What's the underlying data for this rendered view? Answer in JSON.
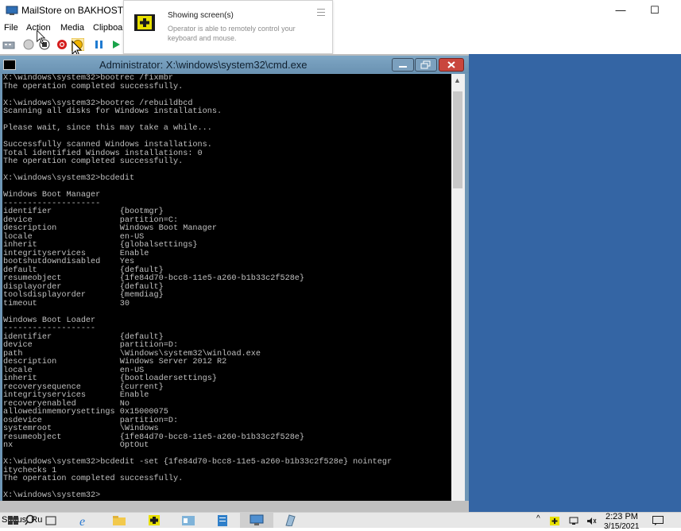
{
  "window": {
    "title": "MailStore on BAKHOST1 - V",
    "minimize_glyph": "—",
    "maximize_glyph": "☐"
  },
  "menu": [
    "File",
    "Action",
    "Media",
    "Clipboa"
  ],
  "toolbar_icons": [
    "ctrl-alt-del-icon",
    "start-icon",
    "turn-off-icon",
    "shutdown-icon",
    "save-icon",
    "pause-icon",
    "reset-icon"
  ],
  "toast": {
    "title": "Showing screen(s)",
    "body": "Operator is able to remotely control your keyboard and mouse.",
    "menu_glyph": "☰"
  },
  "cmd": {
    "title": "Administrator: X:\\windows\\system32\\cmd.exe",
    "lines": [
      "X:\\windows\\system32>bootrec /fixmbr",
      "The operation completed successfully.",
      "",
      "X:\\windows\\system32>bootrec /rebuildbcd",
      "Scanning all disks for Windows installations.",
      "",
      "Please wait, since this may take a while...",
      "",
      "Successfully scanned Windows installations.",
      "Total identified Windows installations: 0",
      "The operation completed successfully.",
      "",
      "X:\\windows\\system32>bcdedit",
      "",
      "Windows Boot Manager",
      "--------------------",
      "identifier              {bootmgr}",
      "device                  partition=C:",
      "description             Windows Boot Manager",
      "locale                  en-US",
      "inherit                 {globalsettings}",
      "integrityservices       Enable",
      "bootshutdowndisabled    Yes",
      "default                 {default}",
      "resumeobject            {1fe84d70-bcc8-11e5-a260-b1b33c2f528e}",
      "displayorder            {default}",
      "toolsdisplayorder       {memdiag}",
      "timeout                 30",
      "",
      "Windows Boot Loader",
      "-------------------",
      "identifier              {default}",
      "device                  partition=D:",
      "path                    \\Windows\\system32\\winload.exe",
      "description             Windows Server 2012 R2",
      "locale                  en-US",
      "inherit                 {bootloadersettings}",
      "recoverysequence        {current}",
      "integrityservices       Enable",
      "recoveryenabled         No",
      "allowedinmemorysettings 0x15000075",
      "osdevice                partition=D:",
      "systemroot              \\Windows",
      "resumeobject            {1fe84d70-bcc8-11e5-a260-b1b33c2f528e}",
      "nx                      OptOut",
      "",
      "X:\\windows\\system32>bcdedit -set {1fe84d70-bcc8-11e5-a260-b1b33c2f528e} nointegr",
      "itychecks 1",
      "The operation completed successfully.",
      "",
      "X:\\windows\\system32>"
    ]
  },
  "taskbar": {
    "status": "Status: Ru",
    "time": "2:23 PM",
    "date": "3/15/2021"
  },
  "colors": {
    "desktop": "#3465a4",
    "cmd_title": "#6e96b6",
    "console_bg": "#000000",
    "console_fg": "#c0c0c0"
  }
}
